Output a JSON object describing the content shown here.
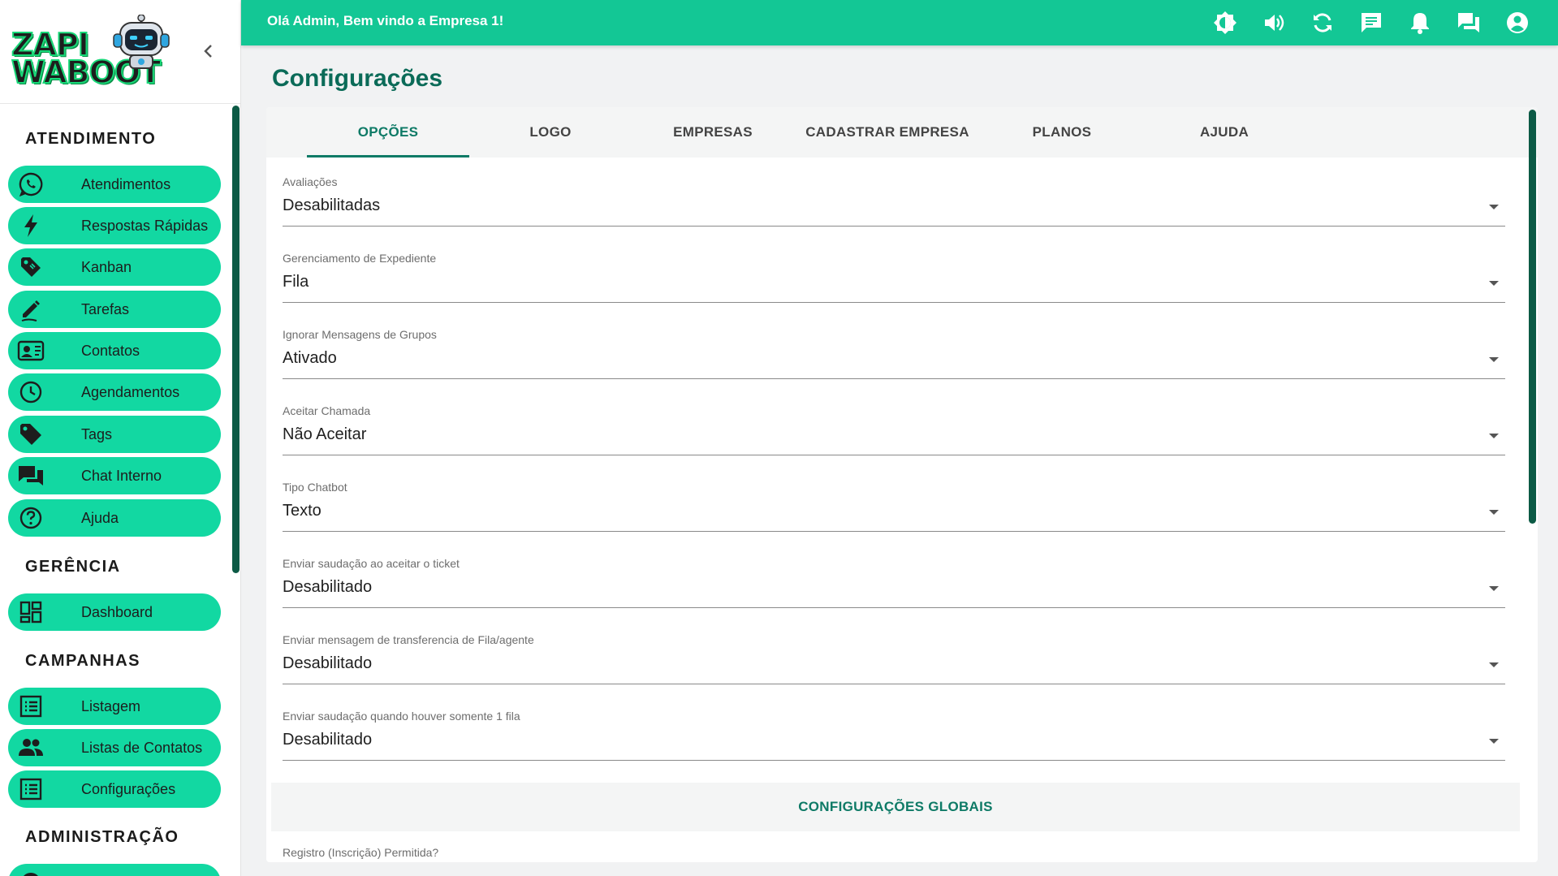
{
  "brand": {
    "logo_line1": "ZAPI",
    "logo_line2": "WABOOT"
  },
  "header": {
    "welcome": "Olá Admin, Bem vindo a Empresa 1!"
  },
  "sidebar": {
    "sections": [
      {
        "title": "ATENDIMENTO"
      },
      {
        "title": "GERÊNCIA"
      },
      {
        "title": "CAMPANHAS"
      },
      {
        "title": "ADMINISTRAÇÃO"
      }
    ],
    "items": [
      {
        "label": "Atendimentos",
        "icon": "whatsapp-icon"
      },
      {
        "label": "Respostas Rápidas",
        "icon": "bolt-icon"
      },
      {
        "label": "Kanban",
        "icon": "tag-icon"
      },
      {
        "label": "Tarefas",
        "icon": "pencil-icon"
      },
      {
        "label": "Contatos",
        "icon": "contact-card-icon"
      },
      {
        "label": "Agendamentos",
        "icon": "clock-icon"
      },
      {
        "label": "Tags",
        "icon": "label-icon"
      },
      {
        "label": "Chat Interno",
        "icon": "chat-icon"
      },
      {
        "label": "Ajuda",
        "icon": "help-icon"
      },
      {
        "label": "Dashboard",
        "icon": "dashboard-icon"
      },
      {
        "label": "Listagem",
        "icon": "list-icon"
      },
      {
        "label": "Listas de Contatos",
        "icon": "people-icon"
      },
      {
        "label": "Configurações",
        "icon": "list-icon"
      }
    ]
  },
  "page": {
    "title": "Configurações"
  },
  "tabs": [
    {
      "label": "OPÇÕES",
      "active": true
    },
    {
      "label": "LOGO"
    },
    {
      "label": "EMPRESAS"
    },
    {
      "label": "CADASTRAR EMPRESA"
    },
    {
      "label": "PLANOS"
    },
    {
      "label": "AJUDA"
    }
  ],
  "fields": [
    {
      "label": "Avaliações",
      "value": "Desabilitadas"
    },
    {
      "label": "Gerenciamento de Expediente",
      "value": "Fila"
    },
    {
      "label": "Ignorar Mensagens de Grupos",
      "value": "Ativado"
    },
    {
      "label": "Aceitar Chamada",
      "value": "Não Aceitar"
    },
    {
      "label": "Tipo Chatbot",
      "value": "Texto"
    },
    {
      "label": "Enviar saudação ao aceitar o ticket",
      "value": "Desabilitado"
    },
    {
      "label": "Enviar mensagem de transferencia de Fila/agente",
      "value": "Desabilitado"
    },
    {
      "label": "Enviar saudação quando houver somente 1 fila",
      "value": "Desabilitado"
    }
  ],
  "global_section": {
    "title": "CONFIGURAÇÕES GLOBAIS"
  },
  "global_fields": [
    {
      "label": "Registro (Inscrição) Permitida?"
    }
  ],
  "colors": {
    "accent": "#13c795",
    "nav_pill": "#12d8a2",
    "title": "#0b6b58",
    "tab_active": "#0e7a66"
  }
}
